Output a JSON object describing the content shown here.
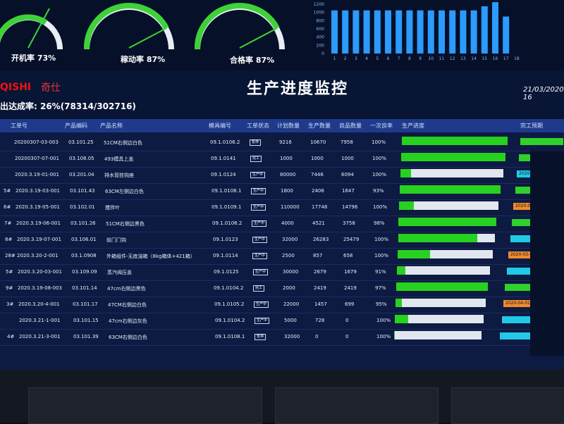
{
  "gauges": [
    {
      "label": "开机率 73%",
      "value": 73
    },
    {
      "label": "稼动率 87%",
      "value": 87
    },
    {
      "label": "合格率 87%",
      "value": 87
    }
  ],
  "bar_chart": {
    "y_ticks": [
      "1200",
      "1000",
      "800",
      "600",
      "400",
      "200",
      "0"
    ],
    "x_ticks": [
      "1",
      "2",
      "3",
      "4",
      "5",
      "6",
      "7",
      "8",
      "9",
      "10",
      "11",
      "12",
      "13",
      "14",
      "15",
      "16",
      "17",
      "18"
    ],
    "values": [
      1050,
      1050,
      1050,
      1050,
      1050,
      1050,
      1050,
      1050,
      1050,
      1050,
      1050,
      1050,
      1050,
      1050,
      1150,
      1250,
      900,
      0
    ],
    "color": "#2b9bff"
  },
  "brand": {
    "logo": "QISHI",
    "logo_cn": "奇仕"
  },
  "title": "生产进度监控",
  "date": "21/03/2020 16",
  "summary": "出达成率: 26%(78314/302716)",
  "headers": [
    "工单号",
    "产品编码",
    "产品名称",
    "模具编号",
    "工单状态",
    "计划数量",
    "生产数量",
    "良品数量",
    "一次良率",
    "生产进度",
    "完工预期"
  ],
  "rows": [
    {
      "idx": "",
      "order": "20200307-03-003",
      "code": "03.101.25",
      "name": "51CM右侧边白色",
      "mold": "09.1.0106.2",
      "status": "暂停",
      "plan": "9216",
      "produced": "10670",
      "good": "7958",
      "yield": "100%",
      "progress": 100,
      "fin": "",
      "fin_color": "#2fd12a"
    },
    {
      "idx": "",
      "order": "20200307-07-001",
      "code": "03.108.05",
      "name": "493模具上盖",
      "mold": "09.1.0141",
      "status": "完工",
      "plan": "1000",
      "produced": "1000",
      "good": "1000",
      "yield": "100%",
      "progress": 100,
      "fin": "",
      "fin_color": "#2fd12a"
    },
    {
      "idx": "",
      "order": "2020.3.19-01-001",
      "code": "03.201.04",
      "name": "排水管挂钩座",
      "mold": "09.1.0124",
      "status": "生产中",
      "plan": "80000",
      "produced": "7446",
      "good": "6094",
      "yield": "100%",
      "progress": 10,
      "fin": "2020-04-01 08",
      "fin_color": "#21c9e6"
    },
    {
      "idx": "5#",
      "order": "2020.3.19-03-001",
      "code": "03.101.43",
      "name": "63CM左侧边白色",
      "mold": "09.1.0108.1",
      "status": "生产中",
      "plan": "1800",
      "produced": "2406",
      "good": "1647",
      "yield": "93%",
      "progress": 100,
      "fin": "",
      "fin_color": "#2fd12a"
    },
    {
      "idx": "6#",
      "order": "2020.3.19-05-001",
      "code": "03.102.01",
      "name": "搅拌叶",
      "mold": "09.1.0109.1",
      "status": "生产中",
      "plan": "110000",
      "produced": "17748",
      "good": "14796",
      "yield": "100%",
      "progress": 15,
      "fin": "2020-04-01 08:0",
      "fin_color": "#f08a2a"
    },
    {
      "idx": "7#",
      "order": "2020.3.19-06-001",
      "code": "03.101.26",
      "name": "51CM右侧边黑色",
      "mold": "09.1.0106.2",
      "status": "生产中",
      "plan": "4000",
      "produced": "4521",
      "good": "3758",
      "yield": "98%",
      "progress": 100,
      "fin": "",
      "fin_color": "#2fd12a"
    },
    {
      "idx": "8#",
      "order": "2020.3.19-07-001",
      "code": "03.106.01",
      "name": "前门门钩",
      "mold": "09.1.0123",
      "status": "生产中",
      "plan": "32000",
      "produced": "26283",
      "good": "25479",
      "yield": "100%",
      "progress": 82,
      "fin": "",
      "fin_color": "#21c9e6"
    },
    {
      "idx": "28#",
      "order": "2020.3.20-2-001",
      "code": "03.1.0908",
      "name": "外箱组件-无底油箱（8kg箱体+421箱）",
      "mold": "09.1.0114",
      "status": "生产中",
      "plan": "2500",
      "produced": "857",
      "good": "658",
      "yield": "100%",
      "progress": 34,
      "fin": "2020-03-31 13:2",
      "fin_color": "#f08a2a"
    },
    {
      "idx": "5#",
      "order": "2020.3.20-03-001",
      "code": "03.109.09",
      "name": "蒸汽阀压盖",
      "mold": "09.1.0125",
      "status": "生产中",
      "plan": "30000",
      "produced": "2679",
      "good": "1679",
      "yield": "91%",
      "progress": 9,
      "fin": "",
      "fin_color": "#21c9e6"
    },
    {
      "idx": "9#",
      "order": "2020.3.19-08-003",
      "code": "03.101.14",
      "name": "47cm右侧边黑色",
      "mold": "09.1.0104.2",
      "status": "完工",
      "plan": "2000",
      "produced": "2419",
      "good": "2419",
      "yield": "97%",
      "progress": 100,
      "fin": "",
      "fin_color": "#2fd12a"
    },
    {
      "idx": "3#",
      "order": "2020.3.20-4-001",
      "code": "03.101.17",
      "name": "47CM右侧边白色",
      "mold": "09.1.0105.2",
      "status": "生产中",
      "plan": "22000",
      "produced": "1457",
      "good": "699",
      "yield": "95%",
      "progress": 7,
      "fin": "2020-04-01 08:0",
      "fin_color": "#f08a2a"
    },
    {
      "idx": "",
      "order": "2020.3.21-1-001",
      "code": "03.101.15",
      "name": "47cm右侧边灰色",
      "mold": "09.1.0104.2",
      "status": "生产中",
      "plan": "5000",
      "produced": "728",
      "good": "0",
      "yield": "100%",
      "progress": 15,
      "fin": "",
      "fin_color": "#21c9e6"
    },
    {
      "idx": "4#",
      "order": "2020.3.21-3-001",
      "code": "03.101.39",
      "name": "63CM右侧边白色",
      "mold": "09.1.0108.1",
      "status": "暂停",
      "plan": "32000",
      "produced": "0",
      "good": "0",
      "yield": "100%",
      "progress": 1,
      "fin": "",
      "fin_color": "#21c9e6"
    }
  ]
}
